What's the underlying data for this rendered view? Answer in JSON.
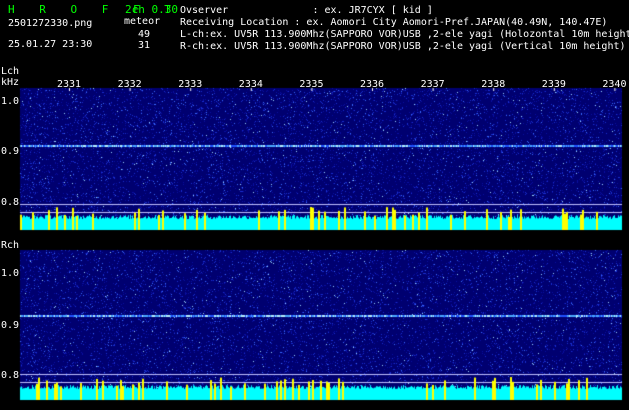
{
  "header": {
    "title": "H R O F F T",
    "mode": "2ch 0.30",
    "filename": "2501272330.png",
    "datetime": "25.01.27 23:30",
    "meteor_label": "meteor",
    "meteor_count_l": "49",
    "meteor_count_r": "31",
    "observer": "Ovserver              : ex. JR7CYX [ kid ]",
    "location": "Receiving Location : ex. Aomori City Aomori-Pref.JAPAN(40.49N, 140.47E)",
    "lch_info": "L-ch:ex. UV5R 113.900Mhz(SAPPORO VOR)USB ,2-ele yagi (Holozontal 10m height)",
    "rch_info": "R-ch:ex. UV5R 113.900Mhz(SAPPORO VOR)USB ,2-ele yagi (Vertical 10m height)"
  },
  "panels": {
    "lch": {
      "label": "Lch",
      "unit": "kHz",
      "yticks": [
        "1.0",
        "0.9",
        "0.8"
      ],
      "xticks": [
        "2331",
        "2332",
        "2333",
        "2334",
        "2335",
        "2336",
        "2337",
        "2338",
        "2339",
        "2340"
      ]
    },
    "rch": {
      "label": "Rch",
      "yticks": [
        "1.0",
        "0.9",
        "0.8"
      ]
    }
  },
  "colors": {
    "background": "#000000",
    "spectrogram_base": "#00008b",
    "noise_floor": "#00ffff",
    "meteor_bar": "#ffff00",
    "title_green": "#00ff00"
  }
}
